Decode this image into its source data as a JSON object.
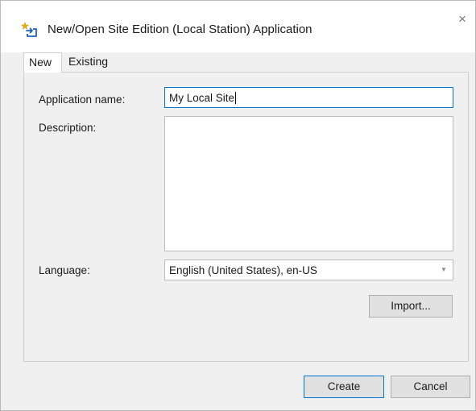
{
  "dialog": {
    "title": "New/Open Site Edition (Local Station) Application",
    "close_glyph": "×",
    "icon": "new-site-icon"
  },
  "tabs": [
    {
      "label": "New",
      "active": true
    },
    {
      "label": "Existing",
      "active": false
    }
  ],
  "form": {
    "application_name_label": "Application name:",
    "application_name_value": "My Local Site",
    "description_label": "Description:",
    "description_value": "",
    "language_label": "Language:",
    "language_value": "English (United States), en-US"
  },
  "buttons": {
    "import_label": "Import...",
    "create_label": "Create",
    "cancel_label": "Cancel"
  },
  "colors": {
    "focus_accent": "#0078d7",
    "dialog_background": "#f0f0f0"
  }
}
